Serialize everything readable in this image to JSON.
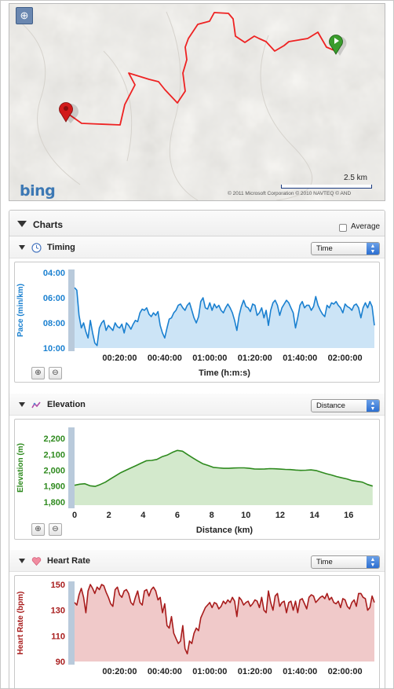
{
  "map": {
    "zoom_icon": "zoom-icon",
    "provider_logo": "bing",
    "scale_label": "2.5 km",
    "copyright": "© 2011 Microsoft Corporation   © 2010 NAVTEQ   © AND"
  },
  "charts_panel": {
    "title": "Charts",
    "average_label": "Average",
    "average_checked": false
  },
  "timing": {
    "title": "Timing",
    "icon": "clock-icon",
    "select_value": "Time",
    "chart_data": {
      "type": "area",
      "ylabel": "Pace (min/km)",
      "xlabel": "Time (h:m:s)",
      "ytick_labels": [
        "04:00",
        "06:00",
        "08:00",
        "10:00"
      ],
      "yticks": [
        4,
        6,
        8,
        10
      ],
      "ylim": [
        4,
        10
      ],
      "y_inverted": true,
      "xtick_labels": [
        "00:20:00",
        "00:40:00",
        "01:00:00",
        "01:20:00",
        "01:40:00",
        "02:00:00"
      ],
      "xticks": [
        20,
        40,
        60,
        80,
        100,
        120
      ],
      "xlim": [
        0,
        133
      ],
      "color": "#1a80d0",
      "fill": "#cce4f6",
      "x": [
        0,
        1,
        2,
        3,
        4,
        5,
        6,
        7,
        8,
        9,
        10,
        11,
        12,
        13,
        14,
        15,
        16,
        17,
        18,
        19,
        20,
        21,
        22,
        23,
        24,
        25,
        26,
        27,
        28,
        29,
        30,
        31,
        32,
        33,
        34,
        35,
        36,
        37,
        38,
        39,
        40,
        41,
        42,
        43,
        44,
        45,
        46,
        47,
        48,
        49,
        50,
        51,
        52,
        53,
        54,
        55,
        56,
        57,
        58,
        59,
        60,
        61,
        62,
        63,
        64,
        65,
        66,
        67,
        68,
        69,
        70,
        71,
        72,
        73,
        74,
        75,
        76,
        77,
        78,
        79,
        80,
        81,
        82,
        83,
        84,
        85,
        86,
        87,
        88,
        89,
        90,
        91,
        92,
        93,
        94,
        95,
        96,
        97,
        98,
        99,
        100,
        101,
        102,
        103,
        104,
        105,
        106,
        107,
        108,
        109,
        110,
        111,
        112,
        113,
        114,
        115,
        116,
        117,
        118,
        119,
        120,
        121,
        122,
        123,
        124,
        125,
        126,
        127,
        128,
        129,
        130,
        131,
        132,
        133
      ],
      "values": [
        5.2,
        5.4,
        7.4,
        8.4,
        8.0,
        8.7,
        9.2,
        7.8,
        8.8,
        9.6,
        9.8,
        8.4,
        8.0,
        7.8,
        8.6,
        8.2,
        8.4,
        8.6,
        8.0,
        8.3,
        8.4,
        8.1,
        8.8,
        8.0,
        8.2,
        8.5,
        8.1,
        7.8,
        7.9,
        7.2,
        6.9,
        7.0,
        6.8,
        7.3,
        7.5,
        7.2,
        7.4,
        7.1,
        8.2,
        8.8,
        9.2,
        8.4,
        7.7,
        7.6,
        7.2,
        7.0,
        6.6,
        6.5,
        6.8,
        7.0,
        6.6,
        6.4,
        7.0,
        7.6,
        8.0,
        7.5,
        6.3,
        6.0,
        6.8,
        6.9,
        6.4,
        7.0,
        6.5,
        6.8,
        6.6,
        7.0,
        7.2,
        6.8,
        6.5,
        6.8,
        7.2,
        7.8,
        8.6,
        7.4,
        6.7,
        6.2,
        6.7,
        6.8,
        7.1,
        6.5,
        6.6,
        7.4,
        7.2,
        6.8,
        7.6,
        7.0,
        8.2,
        7.0,
        6.4,
        6.2,
        6.6,
        7.4,
        6.8,
        6.5,
        6.2,
        6.4,
        6.8,
        7.2,
        8.4,
        7.6,
        6.6,
        6.3,
        6.8,
        6.6,
        6.6,
        7.0,
        6.7,
        5.9,
        6.6,
        7.0,
        7.3,
        7.5,
        6.6,
        6.8,
        6.4,
        6.5,
        6.3,
        6.6,
        6.8,
        7.2,
        6.5,
        6.7,
        6.8,
        7.0,
        6.6,
        6.5,
        6.8,
        7.6,
        6.8,
        6.4,
        6.8,
        6.3,
        6.7,
        8.2
      ]
    }
  },
  "elevation": {
    "title": "Elevation",
    "icon": "elevation-icon",
    "select_value": "Distance",
    "chart_data": {
      "type": "area",
      "ylabel": "Elevation (m)",
      "xlabel": "Distance (km)",
      "ytick_labels": [
        "1,800",
        "1,900",
        "2,000",
        "2,100",
        "2,200"
      ],
      "yticks": [
        1800,
        1900,
        2000,
        2100,
        2200
      ],
      "ylim": [
        1780,
        2250
      ],
      "xtick_labels": [
        "0",
        "2",
        "4",
        "6",
        "8",
        "10",
        "12",
        "14",
        "16"
      ],
      "xticks": [
        0,
        2,
        4,
        6,
        8,
        10,
        12,
        14,
        16
      ],
      "xlim": [
        0,
        17.5
      ],
      "color": "#2e8a1e",
      "fill": "#d3e9cc",
      "x": [
        0,
        0.3,
        0.6,
        0.9,
        1.2,
        1.5,
        1.8,
        2.1,
        2.4,
        2.7,
        3.0,
        3.3,
        3.6,
        3.9,
        4.2,
        4.5,
        4.8,
        5.1,
        5.4,
        5.7,
        6.0,
        6.3,
        6.6,
        6.9,
        7.2,
        7.5,
        7.8,
        8.1,
        8.4,
        8.7,
        9.0,
        9.3,
        9.6,
        9.9,
        10.2,
        10.5,
        10.8,
        11.1,
        11.4,
        11.7,
        12.0,
        12.3,
        12.6,
        12.9,
        13.2,
        13.5,
        13.8,
        14.1,
        14.4,
        14.7,
        15.0,
        15.3,
        15.6,
        15.9,
        16.2,
        16.5,
        16.8,
        17.1,
        17.4
      ],
      "values": [
        1905,
        1912,
        1915,
        1902,
        1898,
        1910,
        1925,
        1945,
        1965,
        1985,
        2000,
        2015,
        2030,
        2045,
        2060,
        2062,
        2068,
        2085,
        2095,
        2112,
        2125,
        2120,
        2098,
        2078,
        2058,
        2040,
        2030,
        2018,
        2015,
        2012,
        2012,
        2014,
        2015,
        2015,
        2012,
        2008,
        2007,
        2008,
        2010,
        2009,
        2007,
        2005,
        2004,
        2001,
        1999,
        2000,
        2002,
        1998,
        1988,
        1978,
        1970,
        1960,
        1952,
        1945,
        1935,
        1930,
        1925,
        1910,
        1900
      ]
    }
  },
  "heart_rate": {
    "title": "Heart Rate",
    "icon": "heart-icon",
    "select_value": "Time",
    "chart_data": {
      "type": "area",
      "ylabel": "Heart Rate (bpm)",
      "ytick_labels": [
        "90",
        "110",
        "130",
        "150"
      ],
      "yticks": [
        90,
        110,
        130,
        150
      ],
      "ylim": [
        90,
        150
      ],
      "xtick_labels": [
        "00:20:00",
        "00:40:00",
        "01:00:00",
        "01:20:00",
        "01:40:00",
        "02:00:00"
      ],
      "xticks": [
        20,
        40,
        60,
        80,
        100,
        120
      ],
      "xlim": [
        0,
        133
      ],
      "color": "#a81c1c",
      "fill": "#f0c9c9",
      "x": [
        0,
        1,
        2,
        3,
        4,
        5,
        6,
        7,
        8,
        9,
        10,
        11,
        12,
        13,
        14,
        15,
        16,
        17,
        18,
        19,
        20,
        21,
        22,
        23,
        24,
        25,
        26,
        27,
        28,
        29,
        30,
        31,
        32,
        33,
        34,
        35,
        36,
        37,
        38,
        39,
        40,
        41,
        42,
        43,
        44,
        45,
        46,
        47,
        48,
        49,
        50,
        51,
        52,
        53,
        54,
        55,
        56,
        57,
        58,
        59,
        60,
        61,
        62,
        63,
        64,
        65,
        66,
        67,
        68,
        69,
        70,
        71,
        72,
        73,
        74,
        75,
        76,
        77,
        78,
        79,
        80,
        81,
        82,
        83,
        84,
        85,
        86,
        87,
        88,
        89,
        90,
        91,
        92,
        93,
        94,
        95,
        96,
        97,
        98,
        99,
        100,
        101,
        102,
        103,
        104,
        105,
        106,
        107,
        108,
        109,
        110,
        111,
        112,
        113,
        114,
        115,
        116,
        117,
        118,
        119,
        120,
        121,
        122,
        123,
        124,
        125,
        126,
        127,
        128,
        129,
        130,
        131,
        132,
        133
      ],
      "values": [
        136,
        134,
        142,
        147,
        140,
        128,
        145,
        150,
        147,
        143,
        148,
        146,
        150,
        149,
        144,
        140,
        135,
        133,
        146,
        148,
        142,
        140,
        145,
        146,
        143,
        136,
        134,
        140,
        145,
        136,
        134,
        145,
        146,
        141,
        146,
        148,
        145,
        138,
        140,
        128,
        135,
        118,
        116,
        125,
        112,
        108,
        104,
        106,
        118,
        100,
        96,
        106,
        104,
        112,
        116,
        114,
        124,
        128,
        132,
        134,
        136,
        132,
        136,
        135,
        131,
        133,
        137,
        135,
        138,
        136,
        140,
        137,
        125,
        140,
        138,
        134,
        136,
        137,
        133,
        135,
        138,
        137,
        132,
        140,
        130,
        128,
        145,
        136,
        130,
        141,
        143,
        133,
        136,
        137,
        128,
        136,
        137,
        130,
        137,
        128,
        138,
        139,
        135,
        131,
        140,
        142,
        141,
        136,
        138,
        140,
        141,
        139,
        143,
        138,
        140,
        136,
        135,
        137,
        132,
        139,
        138,
        133,
        131,
        136,
        138,
        133,
        143,
        143,
        140,
        139,
        130,
        132,
        141,
        136
      ]
    }
  }
}
